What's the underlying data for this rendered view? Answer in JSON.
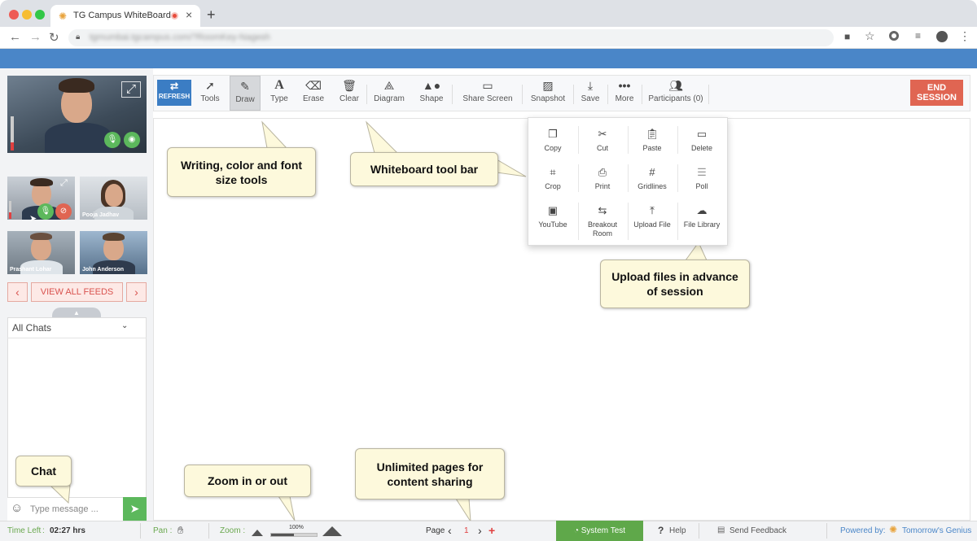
{
  "browser": {
    "tab_title": "TG Campus WhiteBoard",
    "url": "tgmumbai.tgcampus.com/?RoomKey-Nagesh",
    "new_tab_symbol": "+"
  },
  "toolbar": {
    "refresh_label": "REFRESH",
    "tools": [
      {
        "id": "tools",
        "label": "Tools",
        "icon": "cursor-icon"
      },
      {
        "id": "draw",
        "label": "Draw",
        "icon": "pencil-icon"
      },
      {
        "id": "type",
        "label": "Type",
        "icon": "text-icon"
      },
      {
        "id": "erase",
        "label": "Erase",
        "icon": "eraser-icon"
      },
      {
        "id": "clear",
        "label": "Clear",
        "icon": "trash-icon"
      },
      {
        "id": "diagram",
        "label": "Diagram",
        "icon": "compass-icon"
      },
      {
        "id": "shape",
        "label": "Shape",
        "icon": "shapes-icon"
      },
      {
        "id": "share-screen",
        "label": "Share Screen",
        "icon": "monitor-icon"
      },
      {
        "id": "snapshot",
        "label": "Snapshot",
        "icon": "image-icon"
      },
      {
        "id": "save",
        "label": "Save",
        "icon": "download-icon"
      },
      {
        "id": "more",
        "label": "More",
        "icon": "dots-icon"
      },
      {
        "id": "participants",
        "label": "Participants (0)",
        "icon": "people-icon"
      }
    ],
    "end_session_line1": "END",
    "end_session_line2": "SESSION"
  },
  "more_menu": [
    {
      "label": "Copy",
      "icon": "copy-icon"
    },
    {
      "label": "Cut",
      "icon": "scissors-icon"
    },
    {
      "label": "Paste",
      "icon": "paste-icon"
    },
    {
      "label": "Delete",
      "icon": "delete-icon"
    },
    {
      "label": "Crop",
      "icon": "crop-icon"
    },
    {
      "label": "Print",
      "icon": "print-icon"
    },
    {
      "label": "Gridlines",
      "icon": "grid-icon"
    },
    {
      "label": "Poll",
      "icon": "poll-icon"
    },
    {
      "label": "YouTube",
      "icon": "youtube-icon"
    },
    {
      "label": "Breakout Room",
      "icon": "breakout-icon"
    },
    {
      "label": "Upload File",
      "icon": "upload-icon"
    },
    {
      "label": "File Library",
      "icon": "cloud-icon"
    }
  ],
  "participants": [
    {
      "name": ""
    },
    {
      "name": "Pooja Jadhav"
    },
    {
      "name": "Prashant Lohar"
    },
    {
      "name": "John Anderson"
    }
  ],
  "feeds": {
    "view_all_label": "VIEW ALL FEEDS"
  },
  "chat": {
    "filter_value": "All Chats",
    "input_placeholder": "Type message ..."
  },
  "callouts": {
    "writing_tools": "Writing, color and font size tools",
    "toolbar": "Whiteboard tool bar",
    "upload": "Upload files in advance of session",
    "chat": "Chat",
    "zoom": "Zoom in or out",
    "pages": "Unlimited pages for content sharing"
  },
  "status": {
    "time_left_label": "Time Left",
    "time_left_value": "02:27 hrs",
    "pan_label": "Pan :",
    "zoom_label": "Zoom :",
    "zoom_percent_text": "100%",
    "zoom_level": 0.5,
    "page_label": "Page",
    "page_number": "1",
    "system_test": "System Test",
    "help": "Help",
    "send_feedback": "Send Feedback",
    "powered_by": "Powered by:",
    "brand": "Tomorrow's Genius"
  },
  "colors": {
    "accent_blue": "#4a86c8",
    "end_session": "#e06552",
    "system_test": "#5fa84a",
    "callout_bg": "#fdf9dc"
  }
}
